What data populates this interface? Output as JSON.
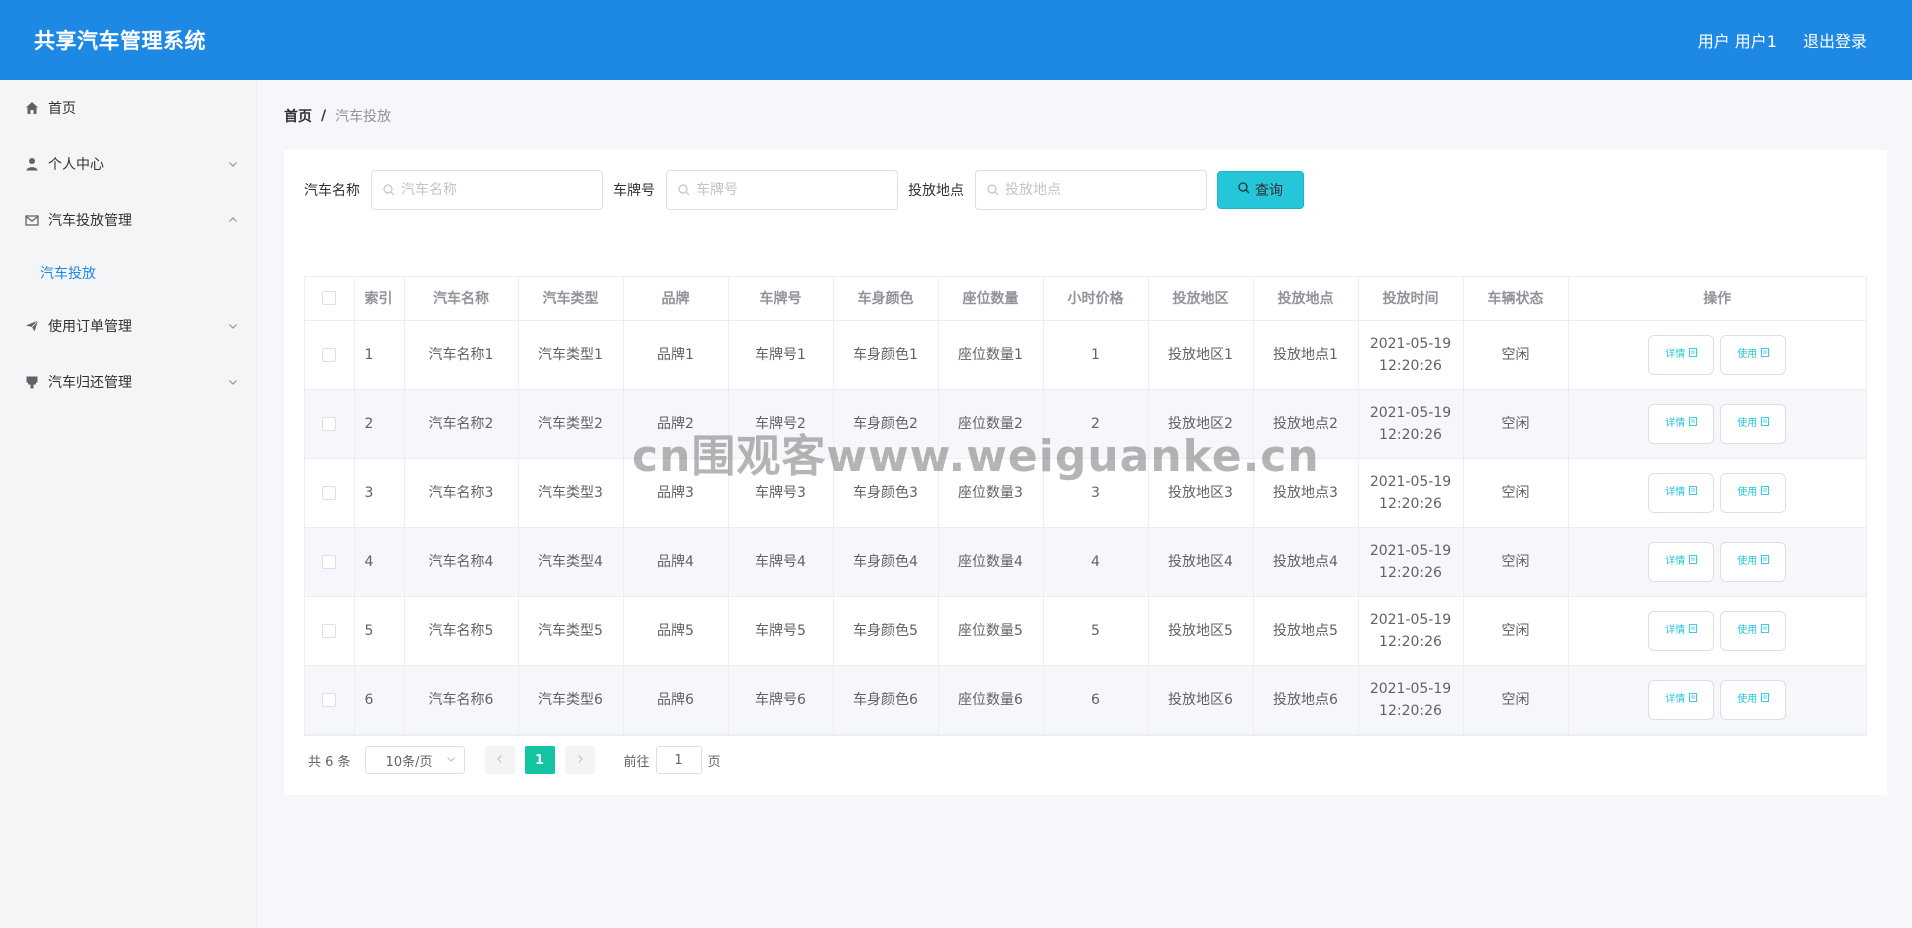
{
  "header": {
    "title": "共享汽车管理系统",
    "user_label": "用户 用户1",
    "logout_label": "退出登录"
  },
  "sidebar": {
    "items": [
      {
        "label": "首页",
        "icon": "home-icon"
      },
      {
        "label": "个人中心",
        "icon": "user-icon",
        "expanded": false
      },
      {
        "label": "汽车投放管理",
        "icon": "mail-icon",
        "expanded": true,
        "children": [
          {
            "label": "汽车投放",
            "active": true
          }
        ]
      },
      {
        "label": "使用订单管理",
        "icon": "send-icon",
        "expanded": false
      },
      {
        "label": "汽车归还管理",
        "icon": "stamp-icon",
        "expanded": false
      }
    ]
  },
  "breadcrumb": {
    "home": "首页",
    "separator": "/",
    "current": "汽车投放"
  },
  "search": {
    "name_label": "汽车名称",
    "name_placeholder": "汽车名称",
    "plate_label": "车牌号",
    "plate_placeholder": "车牌号",
    "location_label": "投放地点",
    "location_placeholder": "投放地点",
    "query_label": "查询"
  },
  "table": {
    "headers": [
      "索引",
      "汽车名称",
      "汽车类型",
      "品牌",
      "车牌号",
      "车身颜色",
      "座位数量",
      "小时价格",
      "投放地区",
      "投放地点",
      "投放时间",
      "车辆状态",
      "操作"
    ],
    "rows": [
      {
        "index": "1",
        "name": "汽车名称1",
        "type": "汽车类型1",
        "brand": "品牌1",
        "plate": "车牌号1",
        "color": "车身颜色1",
        "seats": "座位数量1",
        "price": "1",
        "region": "投放地区1",
        "location": "投放地点1",
        "date": "2021-05-19",
        "time": "12:20:26",
        "status": "空闲"
      },
      {
        "index": "2",
        "name": "汽车名称2",
        "type": "汽车类型2",
        "brand": "品牌2",
        "plate": "车牌号2",
        "color": "车身颜色2",
        "seats": "座位数量2",
        "price": "2",
        "region": "投放地区2",
        "location": "投放地点2",
        "date": "2021-05-19",
        "time": "12:20:26",
        "status": "空闲"
      },
      {
        "index": "3",
        "name": "汽车名称3",
        "type": "汽车类型3",
        "brand": "品牌3",
        "plate": "车牌号3",
        "color": "车身颜色3",
        "seats": "座位数量3",
        "price": "3",
        "region": "投放地区3",
        "location": "投放地点3",
        "date": "2021-05-19",
        "time": "12:20:26",
        "status": "空闲"
      },
      {
        "index": "4",
        "name": "汽车名称4",
        "type": "汽车类型4",
        "brand": "品牌4",
        "plate": "车牌号4",
        "color": "车身颜色4",
        "seats": "座位数量4",
        "price": "4",
        "region": "投放地区4",
        "location": "投放地点4",
        "date": "2021-05-19",
        "time": "12:20:26",
        "status": "空闲"
      },
      {
        "index": "5",
        "name": "汽车名称5",
        "type": "汽车类型5",
        "brand": "品牌5",
        "plate": "车牌号5",
        "color": "车身颜色5",
        "seats": "座位数量5",
        "price": "5",
        "region": "投放地区5",
        "location": "投放地点5",
        "date": "2021-05-19",
        "time": "12:20:26",
        "status": "空闲"
      },
      {
        "index": "6",
        "name": "汽车名称6",
        "type": "汽车类型6",
        "brand": "品牌6",
        "plate": "车牌号6",
        "color": "车身颜色6",
        "seats": "座位数量6",
        "price": "6",
        "region": "投放地区6",
        "location": "投放地点6",
        "date": "2021-05-19",
        "time": "12:20:26",
        "status": "空闲"
      }
    ],
    "detail_label": "详情",
    "use_label": "使用"
  },
  "pagination": {
    "total_label": "共 6 条",
    "page_size_label": "10条/页",
    "current_page": "1",
    "jump_prefix": "前往",
    "jump_value": "1",
    "jump_suffix": "页"
  },
  "watermark": "cn围观客www.weiguanke.cn",
  "colors": {
    "header_bg": "#1e88e5",
    "accent": "#26c6da",
    "active_page": "#13c4a3",
    "submenu_active": "#1e88e5"
  }
}
